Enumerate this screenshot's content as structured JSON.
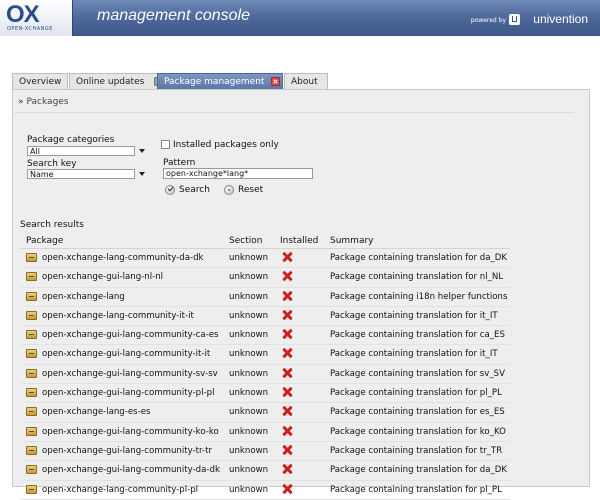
{
  "header": {
    "logo_text": "OX",
    "logo_sub": "OPEN-XCHANGE",
    "title": "management console",
    "powered_by": "powered by",
    "vendor": "univention"
  },
  "tabs": [
    {
      "label": "Overview",
      "active": false,
      "closable": false
    },
    {
      "label": "Online updates",
      "active": false,
      "closable": true
    },
    {
      "label": "Package management",
      "active": true,
      "closable": true
    },
    {
      "label": "About",
      "active": false,
      "closable": false
    }
  ],
  "breadcrumb": {
    "label": "Packages"
  },
  "form": {
    "categories_label": "Package categories",
    "categories_value": "All",
    "installed_only_label": "Installed packages only",
    "search_key_label": "Search key",
    "search_key_value": "Name",
    "pattern_label": "Pattern",
    "pattern_value": "open-xchange*lang*",
    "search_button": "Search",
    "reset_button": "Reset"
  },
  "results": {
    "title": "Search results",
    "columns": {
      "package": "Package",
      "section": "Section",
      "installed": "Installed",
      "summary": "Summary"
    },
    "rows": [
      {
        "package": "open-xchange-lang-community-da-dk",
        "section": "unknown",
        "installed": false,
        "summary": "Package containing translation for da_DK"
      },
      {
        "package": "open-xchange-gui-lang-nl-nl",
        "section": "unknown",
        "installed": false,
        "summary": "Package containing translation for nl_NL"
      },
      {
        "package": "open-xchange-lang",
        "section": "unknown",
        "installed": false,
        "summary": "Package containing i18n helper functions"
      },
      {
        "package": "open-xchange-lang-community-it-it",
        "section": "unknown",
        "installed": false,
        "summary": "Package containing translation for it_IT"
      },
      {
        "package": "open-xchange-gui-lang-community-ca-es",
        "section": "unknown",
        "installed": false,
        "summary": "Package containing translation for ca_ES"
      },
      {
        "package": "open-xchange-gui-lang-community-it-it",
        "section": "unknown",
        "installed": false,
        "summary": "Package containing translation for it_IT"
      },
      {
        "package": "open-xchange-gui-lang-community-sv-sv",
        "section": "unknown",
        "installed": false,
        "summary": "Package containing translation for sv_SV"
      },
      {
        "package": "open-xchange-gui-lang-community-pl-pl",
        "section": "unknown",
        "installed": false,
        "summary": "Package containing translation for pl_PL"
      },
      {
        "package": "open-xchange-lang-es-es",
        "section": "unknown",
        "installed": false,
        "summary": "Package containing translation for es_ES"
      },
      {
        "package": "open-xchange-gui-lang-community-ko-ko",
        "section": "unknown",
        "installed": false,
        "summary": "Package containing translation for ko_KO"
      },
      {
        "package": "open-xchange-gui-lang-community-tr-tr",
        "section": "unknown",
        "installed": false,
        "summary": "Package containing translation for tr_TR"
      },
      {
        "package": "open-xchange-gui-lang-community-da-dk",
        "section": "unknown",
        "installed": false,
        "summary": "Package containing translation for da_DK"
      },
      {
        "package": "open-xchange-lang-community-pl-pl",
        "section": "unknown",
        "installed": false,
        "summary": "Package containing translation for pl_PL"
      }
    ]
  },
  "icons": {
    "tab_close": "close-icon",
    "package": "package-icon",
    "not_installed": "cross-icon",
    "search": "check-icon",
    "reset": "reset-icon"
  },
  "colors": {
    "header": "#4f6a9c",
    "active_tab": "#5b77a7",
    "not_installed": "#cc1f1f",
    "panel": "#eeeeee"
  }
}
